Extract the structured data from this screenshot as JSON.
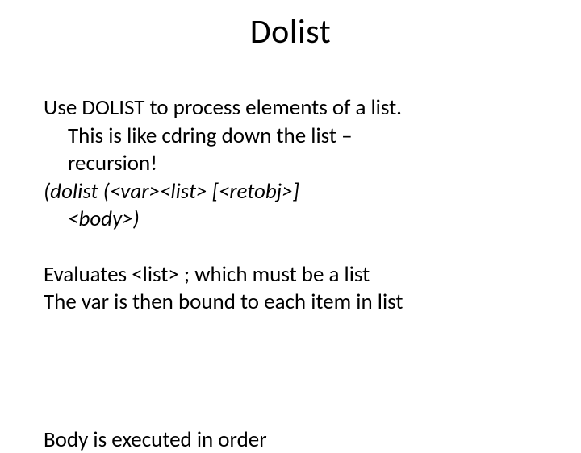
{
  "title": "Dolist",
  "para1_line1": "Use DOLIST to process elements of a list.",
  "para1_line2": "This is like cdring down the list –",
  "para1_line3": "recursion!",
  "syntax_line1": "(dolist (<var><list> [<retobj>]",
  "syntax_line2": "<body>)",
  "para2_line1": "Evaluates <list> ; which must be a list",
  "para2_line2": "The var is then bound to each item in list",
  "cutoff_line": "Body is executed in order"
}
